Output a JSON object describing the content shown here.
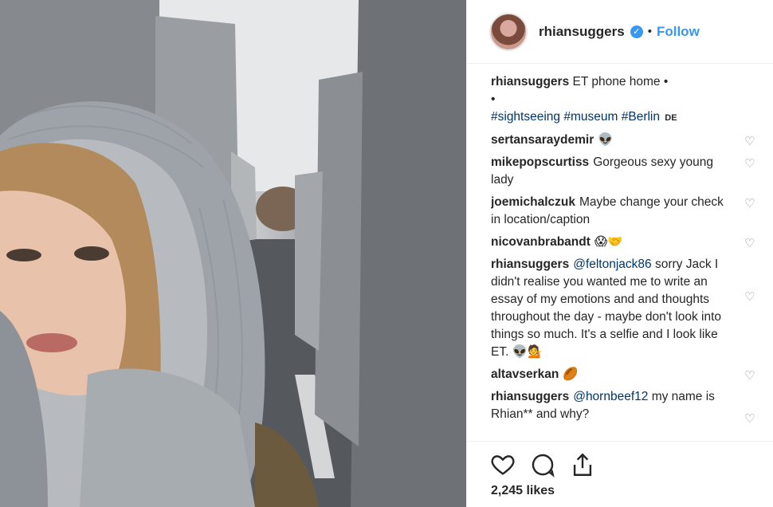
{
  "header": {
    "username": "rhiansuggers",
    "separator": "•",
    "follow_label": "Follow"
  },
  "caption": {
    "username": "rhiansuggers",
    "text": "ET phone home •",
    "line2": "•",
    "tags": [
      "#sightseeing",
      "#museum",
      "#Berlin"
    ],
    "location_badge": "DE"
  },
  "comments": [
    {
      "username": "sertansaraydemir",
      "text": "👽"
    },
    {
      "username": "mikepopscurtiss",
      "text": "Gorgeous sexy young lady"
    },
    {
      "username": "joemichalczuk",
      "text": "Maybe change your check in location/caption"
    },
    {
      "username": "nicovanbrabandt",
      "text": "😱🤝"
    },
    {
      "username": "rhiansuggers",
      "mention": "@feltonjack86",
      "text": "sorry Jack I didn't realise you wanted me to write an essay of my emotions and and thoughts throughout the day - maybe don't look into things so much. It's a selfie and I look like ET. 👽💁"
    },
    {
      "username": "altavserkan",
      "text": "🏉"
    },
    {
      "username": "rhiansuggers",
      "mention": "@hornbeef12",
      "text": "my name is Rhian** and why?"
    }
  ],
  "actions": {
    "like_icon": "heart-icon",
    "comment_icon": "comment-icon",
    "share_icon": "share-icon",
    "likes_text": "2,245 likes"
  }
}
